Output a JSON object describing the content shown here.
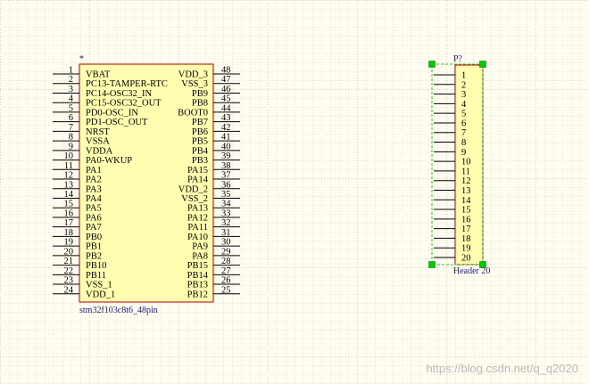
{
  "colors": {
    "background": "#fffdf2",
    "grid_fine": "#ece6cc",
    "grid_major": "#d8d0b0",
    "body_fill": "#fffdb0",
    "body_stroke": "#b00000",
    "pin_line": "#000000",
    "designator_text": "#1a1a80",
    "selection_box": "#22cc22",
    "handle": "#00cc00",
    "watermark": "#b8b8b8"
  },
  "mcu": {
    "designator": "*",
    "comment": "stm32f103c8t6_48pin",
    "left_pins": [
      {
        "num": "1",
        "name": "VBAT"
      },
      {
        "num": "2",
        "name": "PC13-TAMPER-RTC"
      },
      {
        "num": "3",
        "name": "PC14-OSC32_IN"
      },
      {
        "num": "4",
        "name": "PC15-OSC32_OUT"
      },
      {
        "num": "5",
        "name": "PD0-OSC_IN"
      },
      {
        "num": "6",
        "name": "PD1-OSC_OUT"
      },
      {
        "num": "7",
        "name": "NRST"
      },
      {
        "num": "8",
        "name": "VSSA"
      },
      {
        "num": "9",
        "name": "VDDA"
      },
      {
        "num": "10",
        "name": "PA0-WKUP"
      },
      {
        "num": "11",
        "name": "PA1"
      },
      {
        "num": "12",
        "name": "PA2"
      },
      {
        "num": "13",
        "name": "PA3"
      },
      {
        "num": "14",
        "name": "PA4"
      },
      {
        "num": "15",
        "name": "PA5"
      },
      {
        "num": "16",
        "name": "PA6"
      },
      {
        "num": "17",
        "name": "PA7"
      },
      {
        "num": "18",
        "name": "PB0"
      },
      {
        "num": "19",
        "name": "PB1"
      },
      {
        "num": "20",
        "name": "PB2"
      },
      {
        "num": "21",
        "name": "PB10"
      },
      {
        "num": "22",
        "name": "PB11"
      },
      {
        "num": "23",
        "name": "VSS_1"
      },
      {
        "num": "24",
        "name": "VDD_1"
      }
    ],
    "right_pins": [
      {
        "num": "48",
        "name": "VDD_3"
      },
      {
        "num": "47",
        "name": "VSS_3"
      },
      {
        "num": "46",
        "name": "PB9"
      },
      {
        "num": "45",
        "name": "PB8"
      },
      {
        "num": "44",
        "name": "BOOT0"
      },
      {
        "num": "43",
        "name": "PB7"
      },
      {
        "num": "42",
        "name": "PB6"
      },
      {
        "num": "41",
        "name": "PB5"
      },
      {
        "num": "40",
        "name": "PB4"
      },
      {
        "num": "39",
        "name": "PB3"
      },
      {
        "num": "38",
        "name": "PA15"
      },
      {
        "num": "37",
        "name": "PA14"
      },
      {
        "num": "36",
        "name": "VDD_2"
      },
      {
        "num": "35",
        "name": "VSS_2"
      },
      {
        "num": "34",
        "name": "PA13"
      },
      {
        "num": "33",
        "name": "PA12"
      },
      {
        "num": "32",
        "name": "PA11"
      },
      {
        "num": "31",
        "name": "PA10"
      },
      {
        "num": "30",
        "name": "PA9"
      },
      {
        "num": "29",
        "name": "PA8"
      },
      {
        "num": "28",
        "name": "PB15"
      },
      {
        "num": "27",
        "name": "PB14"
      },
      {
        "num": "26",
        "name": "PB13"
      },
      {
        "num": "25",
        "name": "PB12"
      }
    ]
  },
  "header": {
    "designator": "P?",
    "comment": "Header 20",
    "pins": [
      "1",
      "2",
      "3",
      "4",
      "5",
      "6",
      "7",
      "8",
      "9",
      "10",
      "11",
      "12",
      "13",
      "14",
      "15",
      "16",
      "17",
      "18",
      "19",
      "20"
    ]
  },
  "watermark": "https://blog.csdn.net/q_q2020"
}
